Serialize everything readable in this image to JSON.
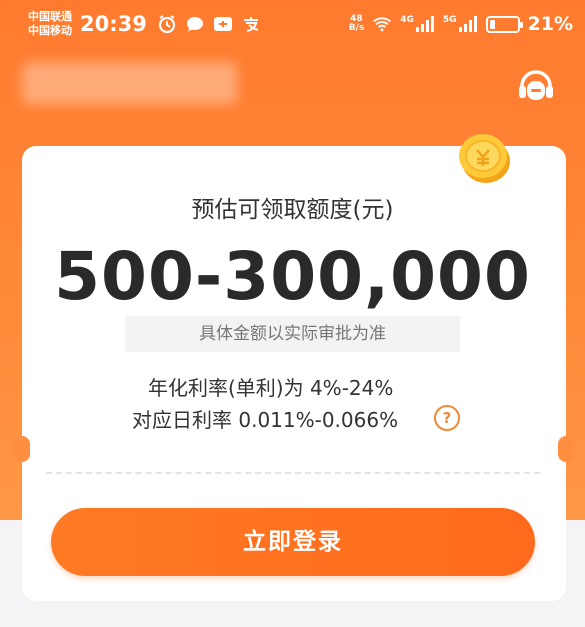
{
  "status_bar": {
    "carrier_1": "中国联通",
    "carrier_2": "中国移动",
    "time": "20:39",
    "net_speed_value": "48",
    "net_speed_unit": "B/s",
    "signal_1": "4G",
    "signal_2": "5G",
    "battery_percent": "21%",
    "battery_level": 0.21
  },
  "card": {
    "title": "预估可领取额度(元)",
    "amount": "500-300,000",
    "note": "具体金额以实际审批为准",
    "annual_rate": "年化利率(单利)为 4%-24%",
    "daily_rate": "对应日利率 0.011%-0.066%",
    "help_icon_text": "?"
  },
  "actions": {
    "login_label": "立即登录"
  },
  "colors": {
    "brand_orange": "#ff7a2e",
    "button_orange": "#ff6a1c",
    "help_icon": "#f08a36"
  },
  "icons": [
    "alarm-icon",
    "message-icon",
    "app-notify-icon",
    "alipay-icon",
    "wifi-icon",
    "signal-icon",
    "battery-icon",
    "customer-service-icon",
    "coin-icon",
    "help-icon"
  ]
}
